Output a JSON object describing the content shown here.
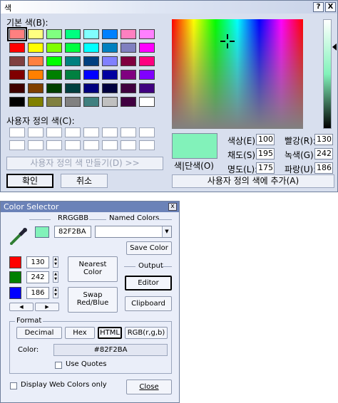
{
  "color_dialog": {
    "title": "색",
    "help_button": "?",
    "close_button": "X",
    "basic_colors_label": "기본 색(B):",
    "basic_colors": [
      "#ff8080",
      "#ffff80",
      "#80ff80",
      "#00ff80",
      "#80ffff",
      "#0080ff",
      "#ff80c0",
      "#ff80ff",
      "#ff0000",
      "#ffff00",
      "#80ff00",
      "#00ff40",
      "#00ffff",
      "#0080c0",
      "#8080c0",
      "#ff00ff",
      "#804040",
      "#ff8040",
      "#00ff00",
      "#008080",
      "#004080",
      "#8080ff",
      "#800040",
      "#ff0080",
      "#800000",
      "#ff8000",
      "#008000",
      "#008040",
      "#0000ff",
      "#0000a0",
      "#800080",
      "#8000ff",
      "#400000",
      "#804000",
      "#004000",
      "#004040",
      "#000080",
      "#000040",
      "#400040",
      "#400080",
      "#000000",
      "#808000",
      "#808040",
      "#808080",
      "#408080",
      "#c0c0c0",
      "#400040",
      "#ffffff"
    ],
    "custom_colors_label": "사용자 정의 색(C):",
    "define_custom_button": "사용자 정의 색 만들기(D) >>",
    "ok_button": "확인",
    "cancel_button": "취소",
    "preview_color": "#82f2ba",
    "preview_label": "색|단색(O)",
    "hue_label": "색상(E):",
    "hue_value": "100",
    "sat_label": "채도(S):",
    "sat_value": "195",
    "lum_label": "명도(L):",
    "lum_value": "175",
    "red_label": "빨강(R):",
    "red_value": "130",
    "green_label": "녹색(G):",
    "green_value": "242",
    "blue_label": "파랑(U):",
    "blue_value": "186",
    "add_custom_button": "사용자 정의 색에 추가(A)"
  },
  "color_selector": {
    "title": "Color Selector",
    "close_button": "x",
    "rrggbb_label": "RRGGBB",
    "named_colors_label": "Named Colors",
    "hex_value": "82F2BA",
    "current_color": "#82f2ba",
    "named_colors_value": "",
    "save_color_button": "Save Color",
    "red_value": "130",
    "green_value": "242",
    "blue_value": "186",
    "nearest_color_button": "Nearest Color",
    "swap_button": "Swap Red/Blue",
    "output_label": "Output",
    "editor_button": "Editor",
    "clipboard_button": "Clipboard",
    "format_label": "Format",
    "format_decimal": "Decimal",
    "format_hex": "Hex",
    "format_html": "HTML",
    "format_rgb": "RGB(r,g,b)",
    "color_label": "Color:",
    "color_output": "#82F2BA",
    "use_quotes_label": "Use Quotes",
    "web_colors_label": "Display Web Colors only",
    "close_label": "Close"
  }
}
